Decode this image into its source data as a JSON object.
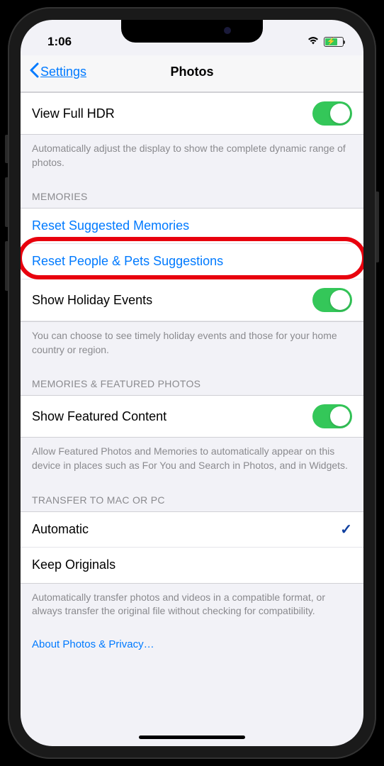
{
  "status_bar": {
    "time": "1:06"
  },
  "nav": {
    "back_label": "Settings",
    "title": "Photos"
  },
  "sections": {
    "hdr": {
      "view_full_hdr": "View Full HDR",
      "footer": "Automatically adjust the display to show the complete dynamic range of photos."
    },
    "memories": {
      "header": "MEMORIES",
      "reset_suggested": "Reset Suggested Memories",
      "reset_people_pets": "Reset People & Pets Suggestions",
      "show_holiday": "Show Holiday Events",
      "footer": "You can choose to see timely holiday events and those for your home country or region."
    },
    "featured": {
      "header": "MEMORIES & FEATURED PHOTOS",
      "show_featured": "Show Featured Content",
      "footer": "Allow Featured Photos and Memories to automatically appear on this device in places such as For You and Search in Photos, and in Widgets."
    },
    "transfer": {
      "header": "TRANSFER TO MAC OR PC",
      "automatic": "Automatic",
      "keep_originals": "Keep Originals",
      "footer": "Automatically transfer photos and videos in a compatible format, or always transfer the original file without checking for compatibility."
    }
  },
  "footer_link": "About Photos & Privacy…"
}
